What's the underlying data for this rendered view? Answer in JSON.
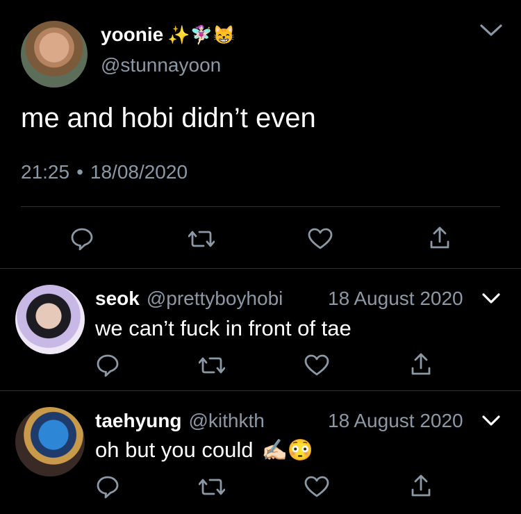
{
  "main_tweet": {
    "display_name": "yoonie",
    "emojis": "✨🧚🏻‍♀️😸",
    "handle": "@stunnayoon",
    "text": "me and hobi didn’t even",
    "time": "21:25",
    "separator": "•",
    "date": "18/08/2020"
  },
  "replies": [
    {
      "display_name": "seok",
      "handle": "@prettyboyhobi",
      "date": "18 August 2020",
      "text": "we can’t fuck in front of tae"
    },
    {
      "display_name": "taehyung",
      "handle": "@kithkth",
      "date": "18 August 2020",
      "text": "oh but you could",
      "emojis": "✍🏻😳"
    }
  ],
  "icons": [
    "reply-icon",
    "retweet-icon",
    "like-icon",
    "share-icon",
    "chevron-down-icon"
  ],
  "colors": {
    "background": "#000000",
    "text": "#ffffff",
    "secondary": "#8b98a5",
    "divider": "#2f3336"
  }
}
